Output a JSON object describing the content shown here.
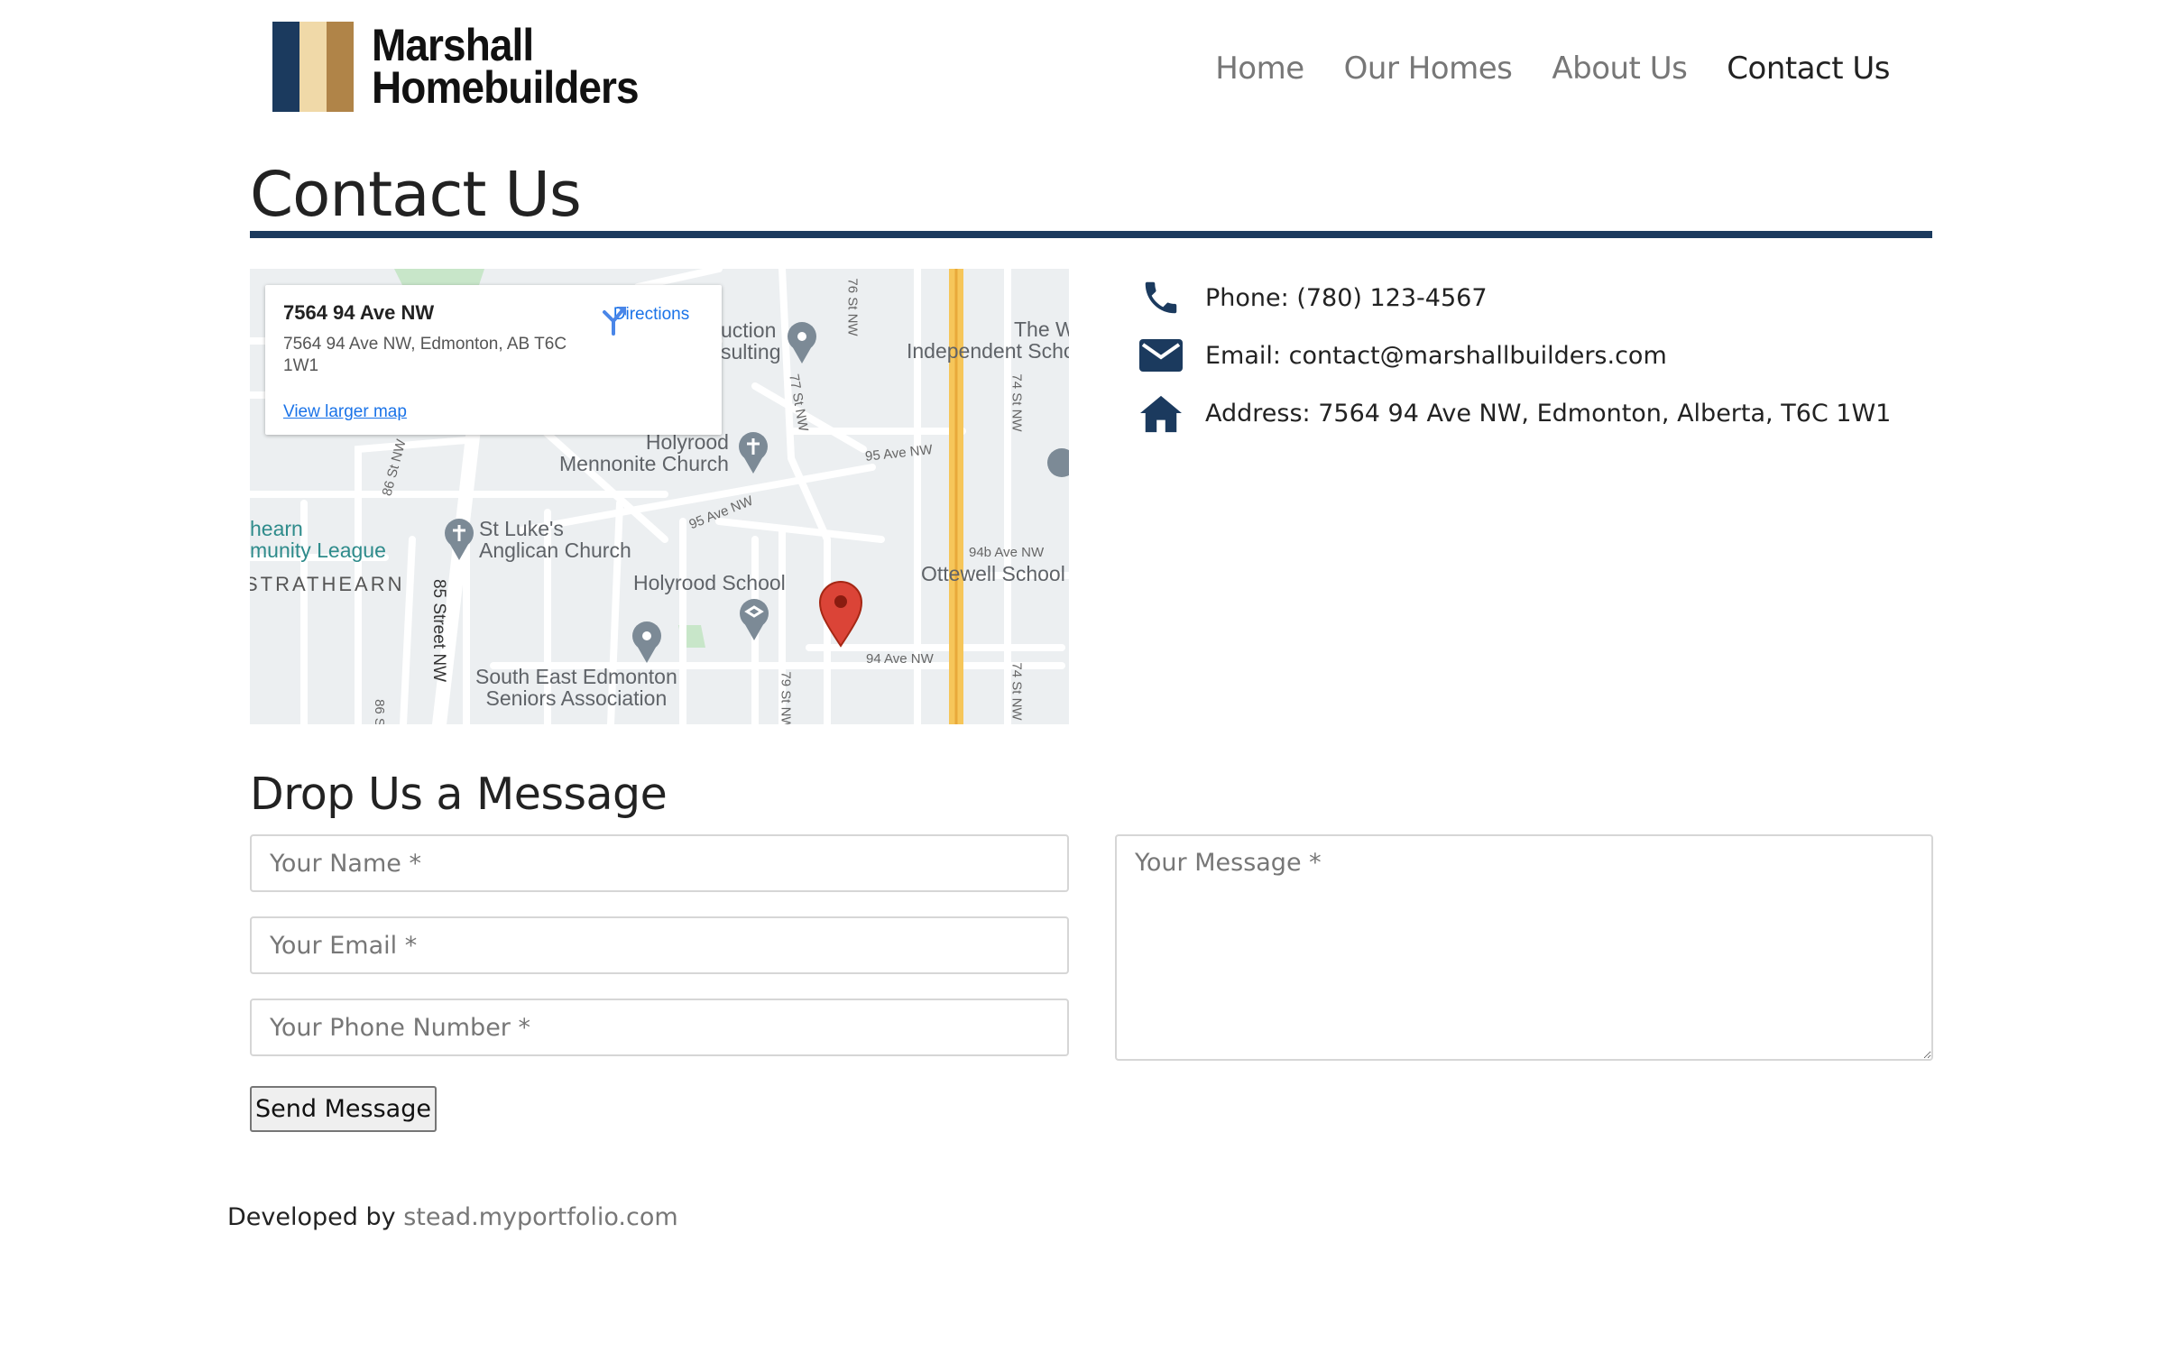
{
  "colors": {
    "navy": "#1b3a5e",
    "gold": "#b08448",
    "cream": "#f0d9a8",
    "accent_rule": "#1b3a5e"
  },
  "logo": {
    "line1": "Marshall",
    "line2": "Homebuilders"
  },
  "nav": {
    "items": [
      {
        "label": "Home"
      },
      {
        "label": "Our Homes"
      },
      {
        "label": "About Us"
      },
      {
        "label": "Contact Us"
      }
    ]
  },
  "page_title": "Contact Us",
  "map": {
    "card_title": "7564 94 Ave NW",
    "card_address": "7564 94 Ave NW, Edmonton, AB T6C 1W1",
    "directions_label": "Directions",
    "larger_map_label": "View larger map",
    "labels": {
      "construction": "uction\nsulting",
      "holyrood_church": "Holyrood\nMennonite Church",
      "st_lukes": "St Luke's\nAnglican Church",
      "holyrood_school": "Holyrood School",
      "se_seniors": "South East Edmonton\nSeniors Association",
      "strathearn": "STRATHEARN",
      "community": "hearn\nmunity League",
      "independent": "The W\nIndependent Scho",
      "ottewell": "Ottewell School",
      "st_85": "85 Street NW",
      "ave_95_a": "95 Ave NW",
      "ave_95_b": "95 Ave NW",
      "ave_94": "94 Ave NW",
      "ave_94b": "94b Ave NW",
      "st_76": "76 St NW",
      "st_77": "77 St NW",
      "st_74_a": "74 St NW",
      "st_74_b": "74 St NW",
      "st_79": "79 St NW",
      "st_86_a": "86 St NW",
      "st_86_b": "86 S"
    }
  },
  "contact": {
    "phone_label": "Phone:",
    "phone_value": "(780) 123-4567",
    "email_label": "Email:",
    "email_value": "contact@marshallbuilders.com",
    "address_label": "Address:",
    "address_value": "7564 94 Ave NW, Edmonton, Alberta, T6C 1W1"
  },
  "form": {
    "title": "Drop Us a Message",
    "name_placeholder": "Your Name *",
    "email_placeholder": "Your Email *",
    "phone_placeholder": "Your Phone Number *",
    "message_placeholder": "Your Message *",
    "send_label": "Send Message"
  },
  "footer": {
    "prefix": "Developed by",
    "link": "stead.myportfolio.com"
  }
}
